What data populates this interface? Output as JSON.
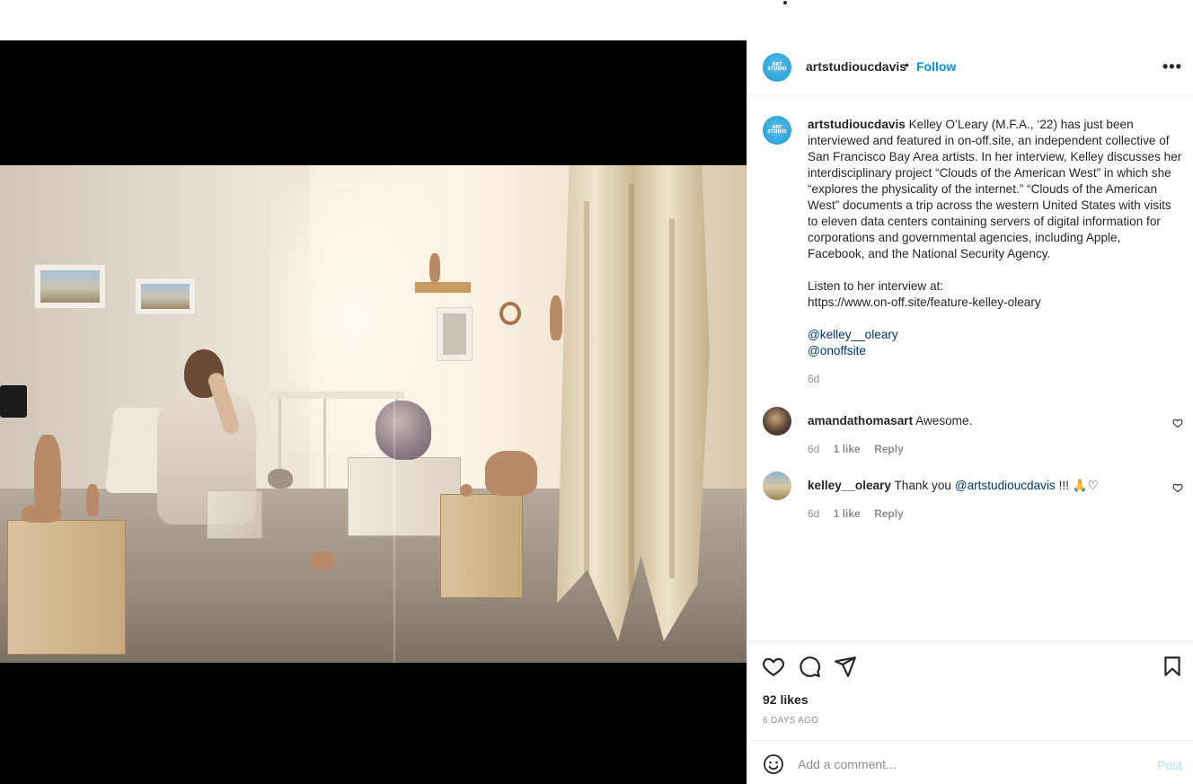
{
  "post": {
    "username": "artstudioucdavis",
    "separator": "•",
    "follow_label": "Follow",
    "more_label": "•••",
    "avatar_text": [
      "ART",
      "STUDIO"
    ],
    "caption": {
      "username": "artstudioucdavis",
      "lines": [
        "Kelley O’Leary (M.F.A., ‘22) has just been",
        "interviewed and featured in on-off.site, an independent collective of",
        "San Francisco Bay Area artists. In her interview, Kelley discusses her",
        "interdisciplinary project “Clouds of the American West” in which she",
        "“explores the physicality of the internet.” “Clouds of the American",
        "West” documents a trip across the western United States with visits",
        "to eleven data centers containing servers of digital information for",
        "corporations and governmental agencies, including Apple,",
        "Facebook, and the National Security Agency."
      ],
      "listen_label": "Listen to her interview at:",
      "interview_url": "https://www.on-off.site/feature-kelley-oleary",
      "mentions": [
        "@kelley__oleary",
        "@onoffsite"
      ],
      "time": "6d"
    },
    "comments": [
      {
        "username": "amandathomasart",
        "text": "Awesome.",
        "time": "6d",
        "likes": "1 like",
        "reply_label": "Reply"
      },
      {
        "username": "kelley__oleary",
        "text_prefix": "Thank you ",
        "mention": "@artstudioucdavis",
        "text_suffix": " !!! 🙏♡",
        "time": "6d",
        "likes": "1 like",
        "reply_label": "Reply"
      }
    ],
    "likes": "92 likes",
    "date": "6 DAYS AGO",
    "add_comment_placeholder": "Add a comment...",
    "post_label": "Post",
    "icons": {
      "like": "heart-icon",
      "comment": "comment-bubble-icon",
      "share": "paper-plane-icon",
      "save": "bookmark-icon",
      "emoji": "emoji-smiley-icon"
    },
    "colors": {
      "follow": "#0095f6",
      "link": "#00376b",
      "muted": "#8e8e8e",
      "post_disabled": "#b2dffc"
    }
  }
}
